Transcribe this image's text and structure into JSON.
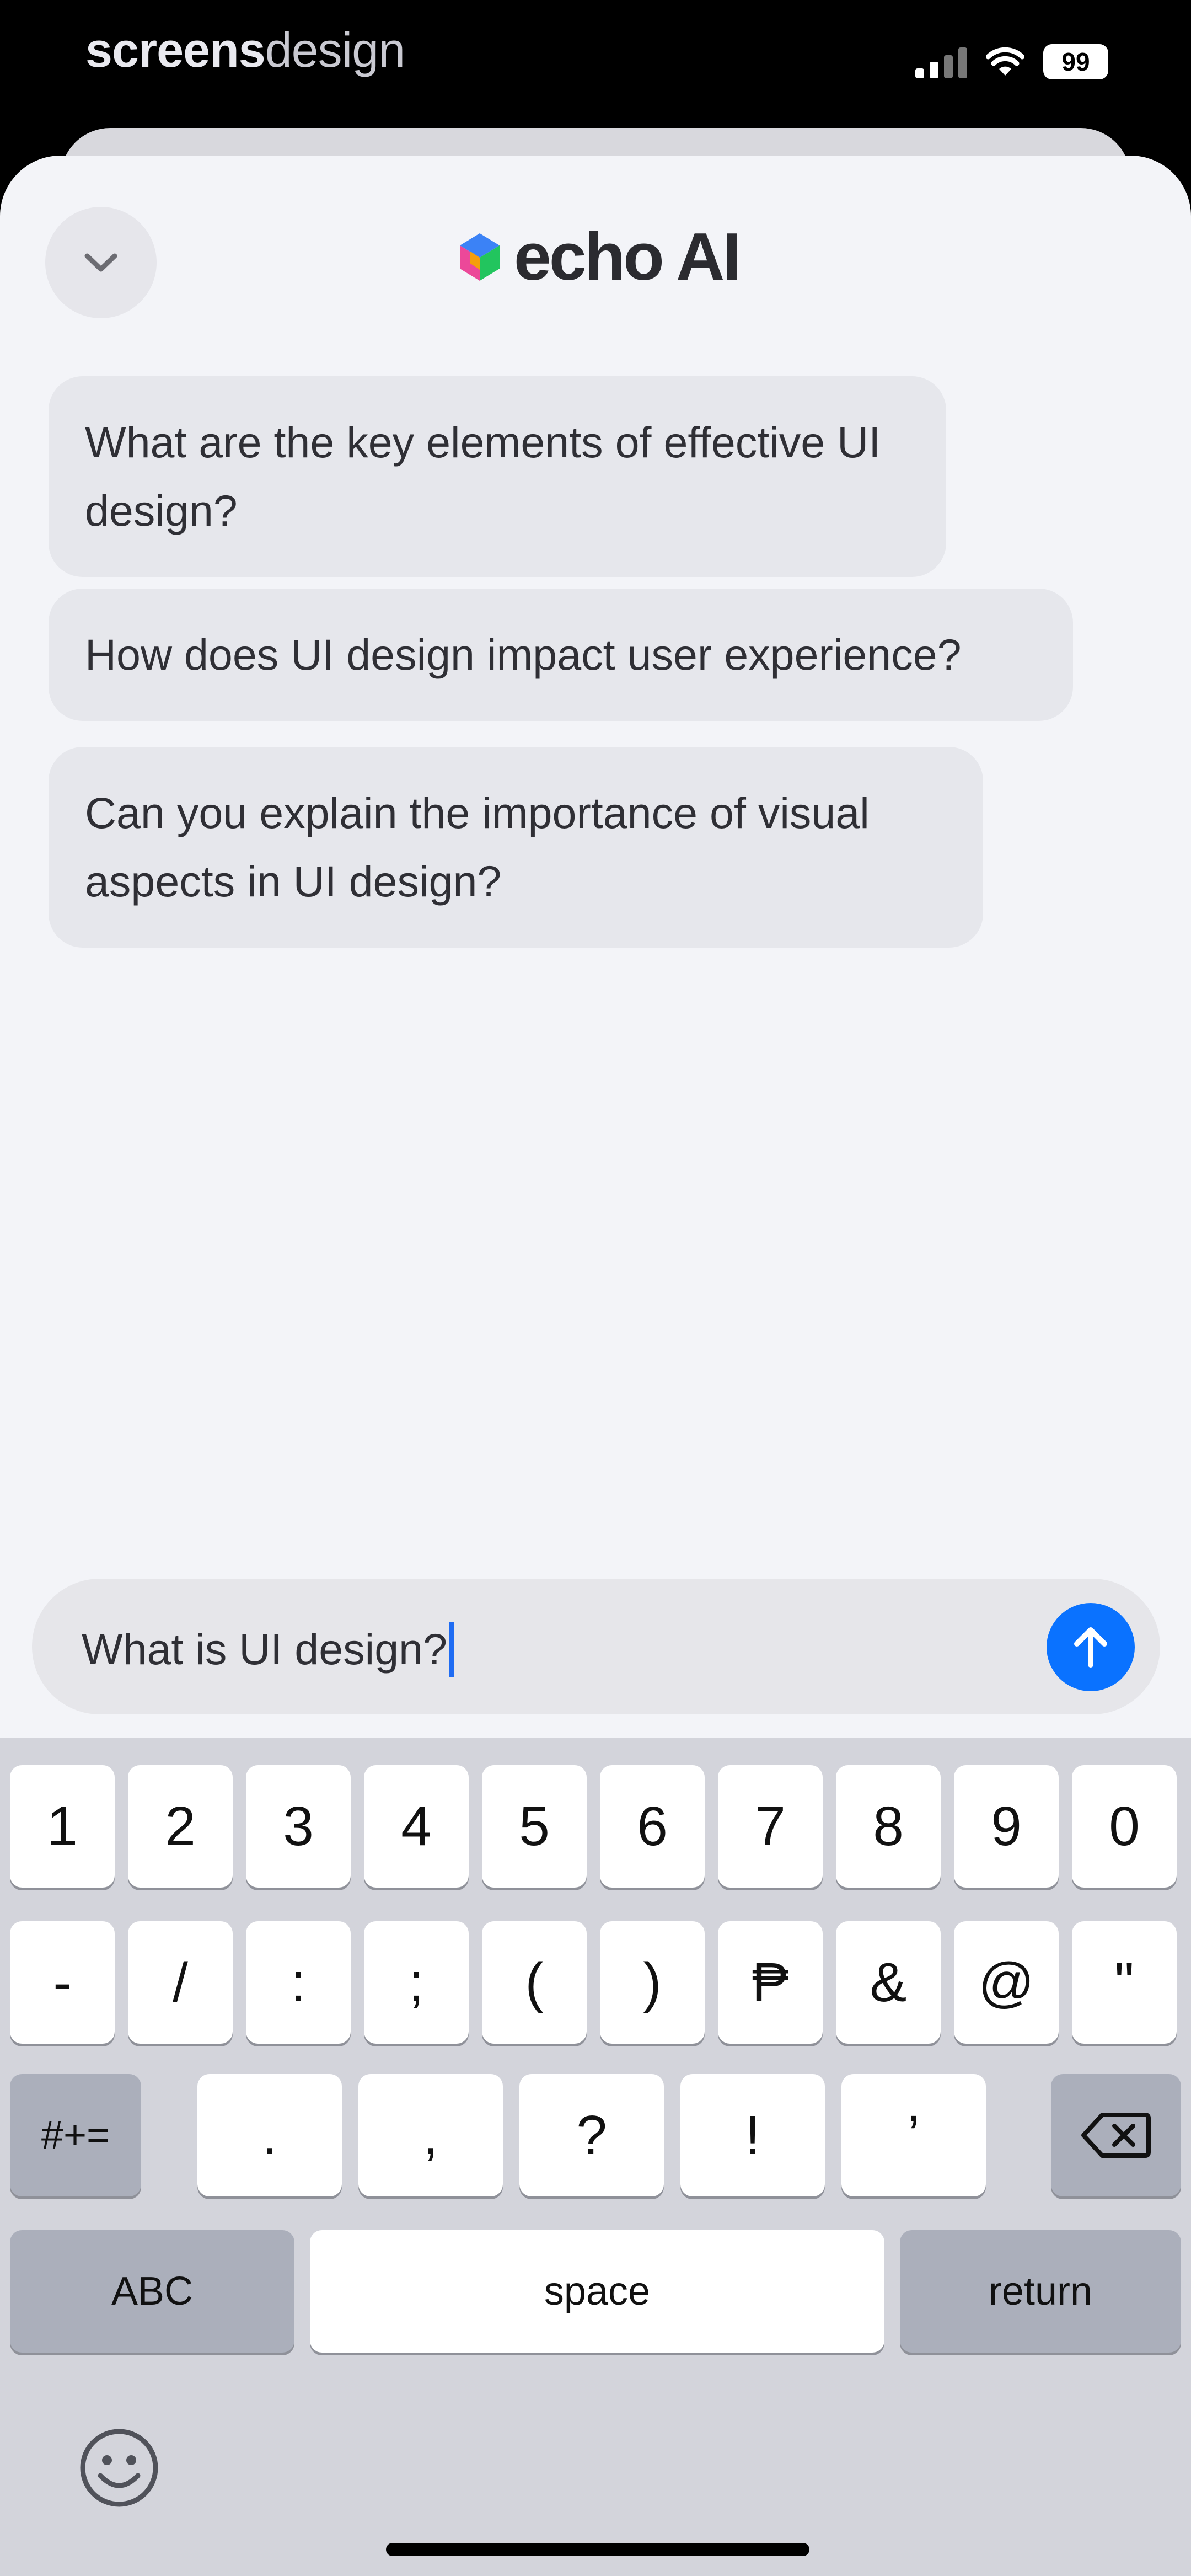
{
  "watermark": {
    "bold": "screens",
    "light": "design"
  },
  "status_bar": {
    "battery": "99"
  },
  "header": {
    "title": "echo AI"
  },
  "messages": [
    {
      "text": "What are the key elements of effective UI design?"
    },
    {
      "text": "How does UI design impact user experience?"
    },
    {
      "text": "Can you explain the importance of visual aspects in UI design?"
    }
  ],
  "composer": {
    "value": "What is UI design?",
    "send_icon": "arrow-up-icon",
    "accent": "#0a72ff"
  },
  "keyboard": {
    "row1": [
      "1",
      "2",
      "3",
      "4",
      "5",
      "6",
      "7",
      "8",
      "9",
      "0"
    ],
    "row2": [
      "-",
      "/",
      ":",
      ";",
      "(",
      ")",
      "₱",
      "&",
      "@",
      "\""
    ],
    "row3": [
      ".",
      ",",
      "?",
      "!",
      "’"
    ],
    "symbols_key": "#+=",
    "abc_key": "ABC",
    "space_key": "space",
    "return_key": "return",
    "emoji_icon": "emoji-face-icon",
    "delete_icon": "backspace-icon"
  }
}
